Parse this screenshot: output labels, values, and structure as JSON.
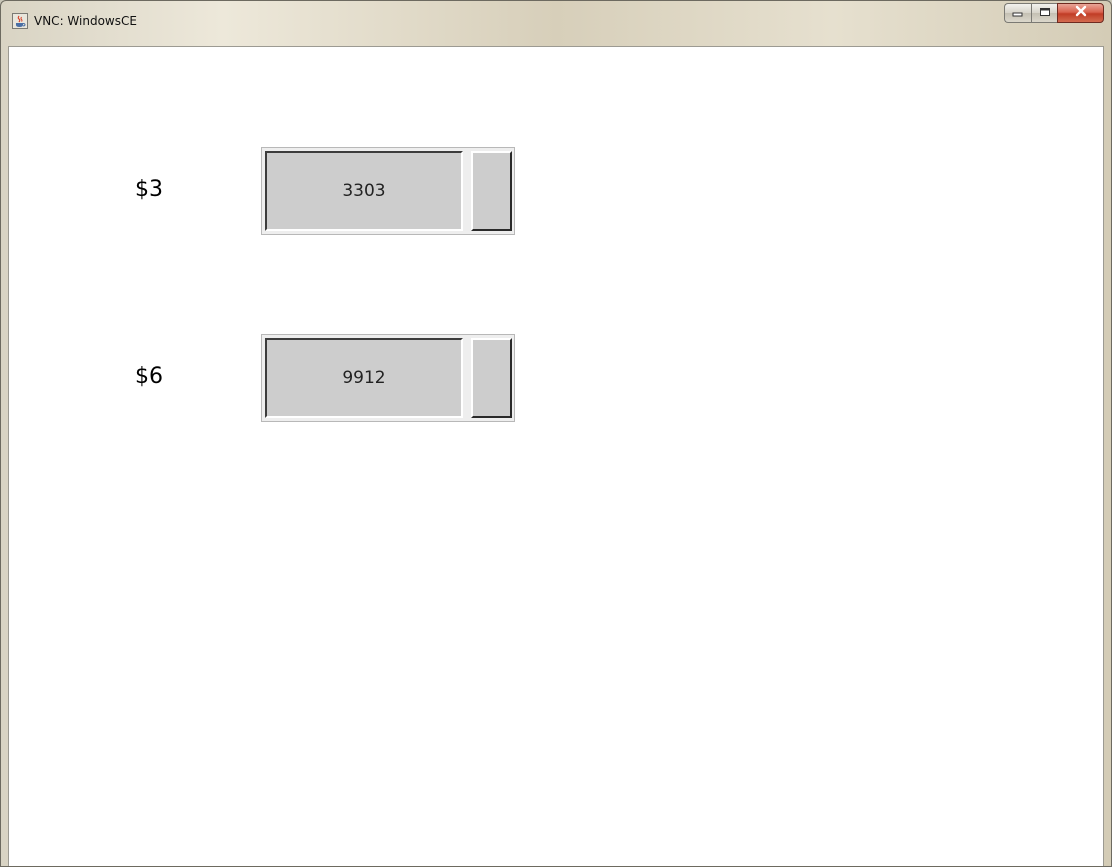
{
  "window": {
    "title": "VNC: WindowsCE",
    "icon": "java-cup-icon",
    "controls": [
      "minimize-icon",
      "maximize-icon",
      "close-icon"
    ]
  },
  "content": {
    "rows": [
      {
        "label": "$3",
        "value": "3303"
      },
      {
        "label": "$6",
        "value": "9912"
      }
    ]
  },
  "colors": {
    "field_bg": "#cdcdcd",
    "close_button": "#c13d26",
    "client_bg": "#ffffff"
  }
}
